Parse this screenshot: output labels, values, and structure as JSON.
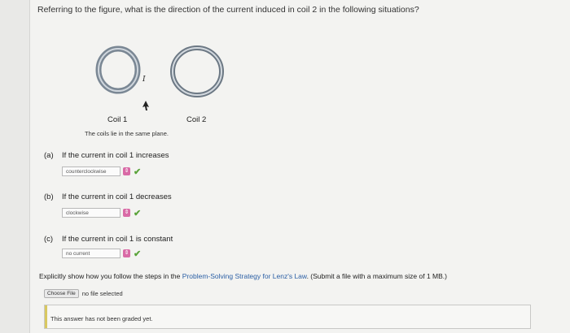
{
  "question": "Referring to the figure, what is the direction of the current induced in coil 2 in the following situations?",
  "figure": {
    "coil1_label": "Coil 1",
    "coil2_label": "Coil 2",
    "current_label": "I",
    "caption": "The coils lie in the same plane."
  },
  "parts": [
    {
      "letter": "(a)",
      "prompt": "If the current in coil 1 increases",
      "answer": "counterclockwise"
    },
    {
      "letter": "(b)",
      "prompt": "If the current in coil 1 decreases",
      "answer": "clockwise"
    },
    {
      "letter": "(c)",
      "prompt": "If the current in coil 1 is constant",
      "answer": "no current"
    }
  ],
  "instruction": {
    "before": "Explicitly show how you follow the steps in the ",
    "link": "Problem-Solving Strategy for Lenz's Law",
    "after": ". (Submit a file with a maximum size of 1 MB.)"
  },
  "file": {
    "button": "Choose File",
    "status": "no file selected"
  },
  "grade": "This answer has not been graded yet.",
  "colors": {
    "check": "#5aa33a",
    "select_arrow": "#d96aa6",
    "link": "#2b5fa5"
  }
}
